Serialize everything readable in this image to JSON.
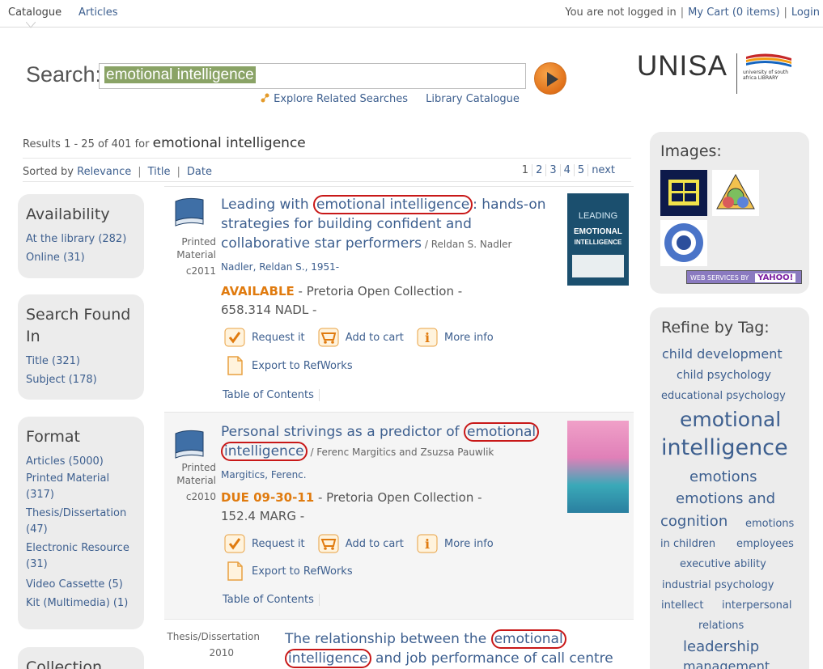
{
  "topbar": {
    "tabs": [
      "Catalogue",
      "Articles"
    ],
    "login_status": "You are not logged in",
    "cart": "My Cart (0 items)",
    "login": "Login"
  },
  "search": {
    "label": "Search:",
    "value": "emotional intelligence",
    "explore": "Explore Related Searches",
    "library_catalogue": "Library Catalogue"
  },
  "logo": {
    "name": "UNISA",
    "subtitle": "university of south africa LIBRARY"
  },
  "results_header": {
    "count_prefix": "Results 1 - 25 of 401 for",
    "query": "emotional intelligence",
    "sorted_by": "Sorted by",
    "sort_options": [
      "Relevance",
      "Title",
      "Date"
    ],
    "pages": [
      "1",
      "2",
      "3",
      "4",
      "5"
    ],
    "next": "next"
  },
  "facets": {
    "availability": {
      "title": "Availability",
      "items": [
        "At the library (282)",
        "Online (31)"
      ]
    },
    "search_found": {
      "title": "Search Found In",
      "items": [
        "Title (321)",
        "Subject (178)"
      ]
    },
    "format": {
      "title": "Format",
      "items": [
        "Articles (5000)",
        "Printed Material (317)",
        "Thesis/Dissertation (47)",
        "Electronic Resource (31)",
        "Video Cassette (5)",
        "Kit (Multimedia) (1)"
      ]
    },
    "collection": {
      "title": "Collection"
    }
  },
  "results": [
    {
      "type": "Printed Material",
      "year": "c2011",
      "title_pre": "Leading with ",
      "title_hl": "emotional intelligence",
      "title_post": ": hands-on strategies for building confident and collaborative star performers",
      "byline": " / Reldan S. Nadler",
      "author": "Nadler, Reldan S., 1951-",
      "status": "AVAILABLE",
      "location": " - Pretoria Open Collection -",
      "callno": "658.314 NADL  -",
      "actions": [
        "Request it",
        "Add to cart",
        "More info"
      ],
      "export": "Export to RefWorks",
      "toc": "Table of Contents",
      "cover_lines": [
        "LEADING",
        "EMOTIONAL",
        "INTELLIGENCE"
      ]
    },
    {
      "type": "Printed Material",
      "year": "c2010",
      "title_pre": "Personal strivings as a predictor of ",
      "title_hl": "emotional",
      "title_hl2": "intelligence",
      "byline": " / Ferenc Margitics and Zsuzsa Pauwlik",
      "author": "Margitics, Ferenc.",
      "status": "DUE 09-30-11",
      "location": " - Pretoria Open Collection -",
      "callno": "152.4 MARG  -",
      "actions": [
        "Request it",
        "Add to cart",
        "More info"
      ],
      "export": "Export to RefWorks",
      "toc": "Table of Contents"
    },
    {
      "type": "Thesis/Dissertation",
      "year": "2010",
      "title_pre": "The relationship between the ",
      "title_hl": "emotional",
      "title_hl2": "intelligence",
      "title_post": " and job performance of call centre"
    }
  ],
  "images_panel": {
    "title": "Images:",
    "badge_prefix": "WEB SERVICES BY",
    "badge_brand": "YAHOO!"
  },
  "tags_panel": {
    "title": "Refine by Tag:",
    "tags": [
      "child development",
      "child psychology",
      "educational psychology",
      "emotional",
      "intelligence",
      "emotions",
      "emotions and",
      "cognition",
      "emotions",
      "in children",
      "employees",
      "executive ability",
      "industrial psychology",
      "intellect",
      "interpersonal",
      "relations",
      "leadership",
      "management"
    ]
  },
  "colors": {
    "link": "#3d5f8f",
    "available": "#e07b0f",
    "panel": "#ececec",
    "highlight_circle": "#c81818",
    "search_highlight": "#8aa366"
  }
}
